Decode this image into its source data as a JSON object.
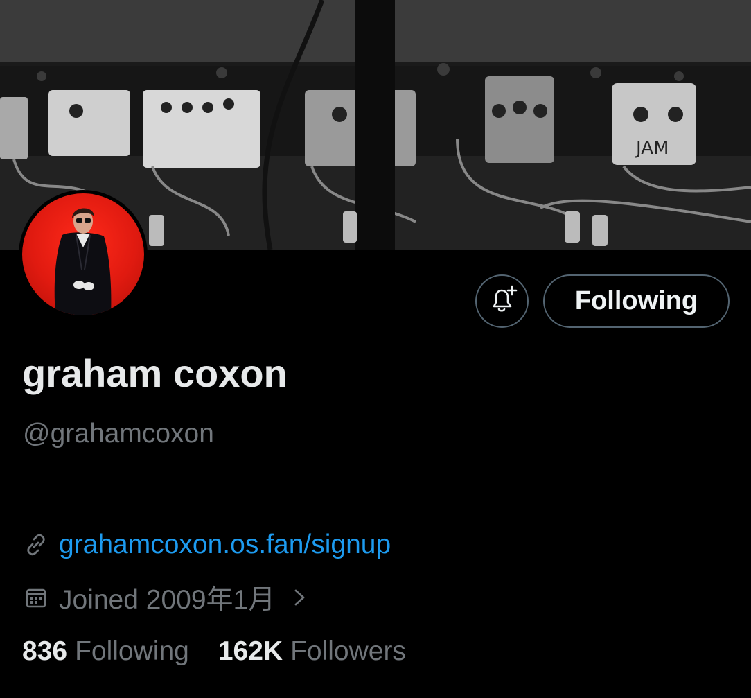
{
  "banner": {
    "pedal_label": "JAM"
  },
  "profile": {
    "display_name": "graham coxon",
    "handle": "@grahamcoxon",
    "link_text": "grahamcoxon.os.fan/signup",
    "joined_text": "Joined 2009年1月"
  },
  "actions": {
    "following_label": "Following"
  },
  "stats": {
    "following_count": "836",
    "following_label": "Following",
    "followers_count": "162K",
    "followers_label": "Followers"
  },
  "icons": {
    "notify": "bell-plus-icon",
    "link": "link-icon",
    "calendar": "calendar-icon",
    "chevron": "chevron-right-icon"
  },
  "colors": {
    "background": "#000000",
    "text": "#e7e9ea",
    "secondary_text": "#71767b",
    "link": "#1d9bf0",
    "border": "#536471",
    "avatar_red": "#e01a10"
  }
}
